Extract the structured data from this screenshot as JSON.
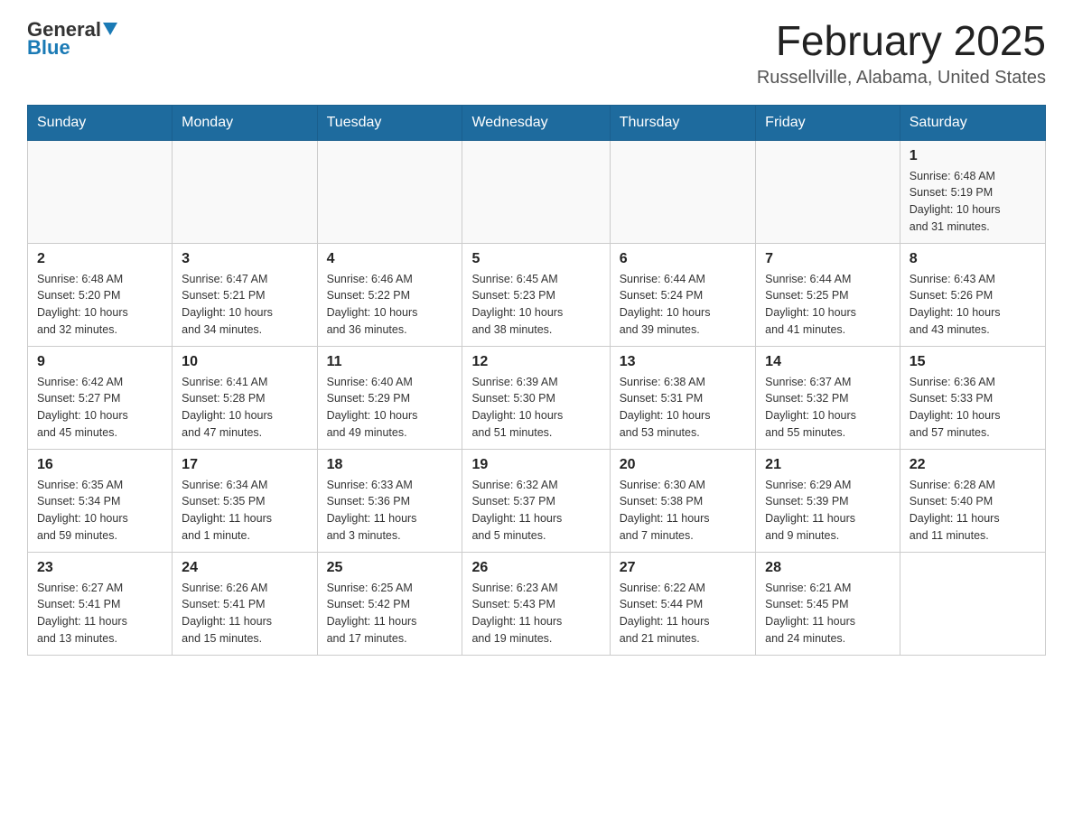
{
  "header": {
    "logo_general": "General",
    "logo_blue": "Blue",
    "month": "February 2025",
    "location": "Russellville, Alabama, United States"
  },
  "days_of_week": [
    "Sunday",
    "Monday",
    "Tuesday",
    "Wednesday",
    "Thursday",
    "Friday",
    "Saturday"
  ],
  "weeks": [
    [
      {
        "day": "",
        "info": ""
      },
      {
        "day": "",
        "info": ""
      },
      {
        "day": "",
        "info": ""
      },
      {
        "day": "",
        "info": ""
      },
      {
        "day": "",
        "info": ""
      },
      {
        "day": "",
        "info": ""
      },
      {
        "day": "1",
        "info": "Sunrise: 6:48 AM\nSunset: 5:19 PM\nDaylight: 10 hours\nand 31 minutes."
      }
    ],
    [
      {
        "day": "2",
        "info": "Sunrise: 6:48 AM\nSunset: 5:20 PM\nDaylight: 10 hours\nand 32 minutes."
      },
      {
        "day": "3",
        "info": "Sunrise: 6:47 AM\nSunset: 5:21 PM\nDaylight: 10 hours\nand 34 minutes."
      },
      {
        "day": "4",
        "info": "Sunrise: 6:46 AM\nSunset: 5:22 PM\nDaylight: 10 hours\nand 36 minutes."
      },
      {
        "day": "5",
        "info": "Sunrise: 6:45 AM\nSunset: 5:23 PM\nDaylight: 10 hours\nand 38 minutes."
      },
      {
        "day": "6",
        "info": "Sunrise: 6:44 AM\nSunset: 5:24 PM\nDaylight: 10 hours\nand 39 minutes."
      },
      {
        "day": "7",
        "info": "Sunrise: 6:44 AM\nSunset: 5:25 PM\nDaylight: 10 hours\nand 41 minutes."
      },
      {
        "day": "8",
        "info": "Sunrise: 6:43 AM\nSunset: 5:26 PM\nDaylight: 10 hours\nand 43 minutes."
      }
    ],
    [
      {
        "day": "9",
        "info": "Sunrise: 6:42 AM\nSunset: 5:27 PM\nDaylight: 10 hours\nand 45 minutes."
      },
      {
        "day": "10",
        "info": "Sunrise: 6:41 AM\nSunset: 5:28 PM\nDaylight: 10 hours\nand 47 minutes."
      },
      {
        "day": "11",
        "info": "Sunrise: 6:40 AM\nSunset: 5:29 PM\nDaylight: 10 hours\nand 49 minutes."
      },
      {
        "day": "12",
        "info": "Sunrise: 6:39 AM\nSunset: 5:30 PM\nDaylight: 10 hours\nand 51 minutes."
      },
      {
        "day": "13",
        "info": "Sunrise: 6:38 AM\nSunset: 5:31 PM\nDaylight: 10 hours\nand 53 minutes."
      },
      {
        "day": "14",
        "info": "Sunrise: 6:37 AM\nSunset: 5:32 PM\nDaylight: 10 hours\nand 55 minutes."
      },
      {
        "day": "15",
        "info": "Sunrise: 6:36 AM\nSunset: 5:33 PM\nDaylight: 10 hours\nand 57 minutes."
      }
    ],
    [
      {
        "day": "16",
        "info": "Sunrise: 6:35 AM\nSunset: 5:34 PM\nDaylight: 10 hours\nand 59 minutes."
      },
      {
        "day": "17",
        "info": "Sunrise: 6:34 AM\nSunset: 5:35 PM\nDaylight: 11 hours\nand 1 minute."
      },
      {
        "day": "18",
        "info": "Sunrise: 6:33 AM\nSunset: 5:36 PM\nDaylight: 11 hours\nand 3 minutes."
      },
      {
        "day": "19",
        "info": "Sunrise: 6:32 AM\nSunset: 5:37 PM\nDaylight: 11 hours\nand 5 minutes."
      },
      {
        "day": "20",
        "info": "Sunrise: 6:30 AM\nSunset: 5:38 PM\nDaylight: 11 hours\nand 7 minutes."
      },
      {
        "day": "21",
        "info": "Sunrise: 6:29 AM\nSunset: 5:39 PM\nDaylight: 11 hours\nand 9 minutes."
      },
      {
        "day": "22",
        "info": "Sunrise: 6:28 AM\nSunset: 5:40 PM\nDaylight: 11 hours\nand 11 minutes."
      }
    ],
    [
      {
        "day": "23",
        "info": "Sunrise: 6:27 AM\nSunset: 5:41 PM\nDaylight: 11 hours\nand 13 minutes."
      },
      {
        "day": "24",
        "info": "Sunrise: 6:26 AM\nSunset: 5:41 PM\nDaylight: 11 hours\nand 15 minutes."
      },
      {
        "day": "25",
        "info": "Sunrise: 6:25 AM\nSunset: 5:42 PM\nDaylight: 11 hours\nand 17 minutes."
      },
      {
        "day": "26",
        "info": "Sunrise: 6:23 AM\nSunset: 5:43 PM\nDaylight: 11 hours\nand 19 minutes."
      },
      {
        "day": "27",
        "info": "Sunrise: 6:22 AM\nSunset: 5:44 PM\nDaylight: 11 hours\nand 21 minutes."
      },
      {
        "day": "28",
        "info": "Sunrise: 6:21 AM\nSunset: 5:45 PM\nDaylight: 11 hours\nand 24 minutes."
      },
      {
        "day": "",
        "info": ""
      }
    ]
  ]
}
